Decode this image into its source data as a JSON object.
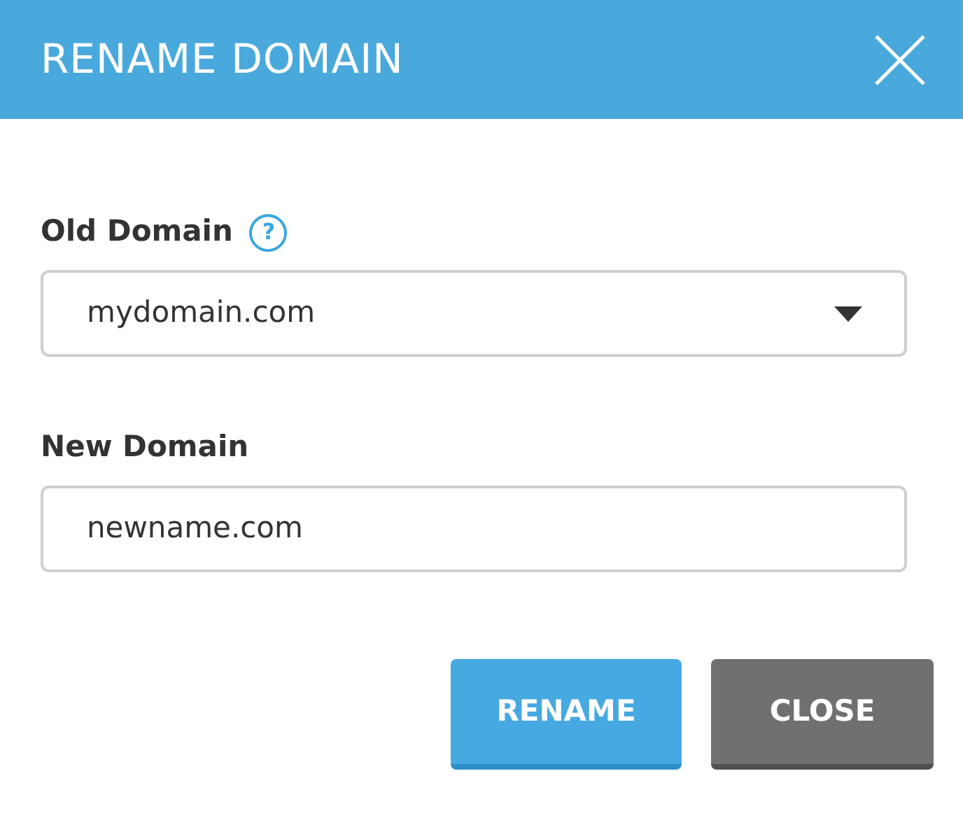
{
  "dialog": {
    "title": "RENAME DOMAIN"
  },
  "fields": [
    {
      "kind": "select",
      "label": "Old Domain",
      "help": "?",
      "value": "mydomain.com"
    },
    {
      "kind": "text",
      "label": "New Domain",
      "value": "newname.com"
    }
  ],
  "buttons": [
    {
      "label": "RENAME",
      "kind": "primary"
    },
    {
      "label": "CLOSE",
      "kind": "secondary"
    }
  ]
}
